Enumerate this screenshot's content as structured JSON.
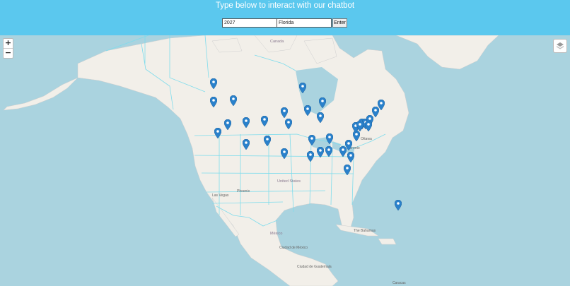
{
  "header": {
    "title": "Type below to interact with our chatbot",
    "year_value": "2027",
    "state_value": "Florida",
    "enter_label": "Enter"
  },
  "map": {
    "zoom_in_label": "+",
    "zoom_out_label": "−",
    "layers_icon": "layers-icon",
    "marker_icon": "map-pin-icon",
    "colors": {
      "water": "#aad3df",
      "land": "#f2efe9",
      "header": "#5bc8ee",
      "borders": "#7fdcec",
      "marker": "#2a81cb"
    },
    "labels": {
      "canada": "Canada",
      "united_states": "United States",
      "mexico": "México",
      "ottawa": "Ottawa",
      "toronto": "Toronto",
      "las_vegas": "Las Vegas",
      "phoenix": "Phoenix",
      "ciudad_de_mexico": "Ciudad de México",
      "guatemala": "Ciudad de Guatemala",
      "caracas": "Caracas",
      "bahamas": "The Bahamas"
    },
    "marker_count": 35
  }
}
